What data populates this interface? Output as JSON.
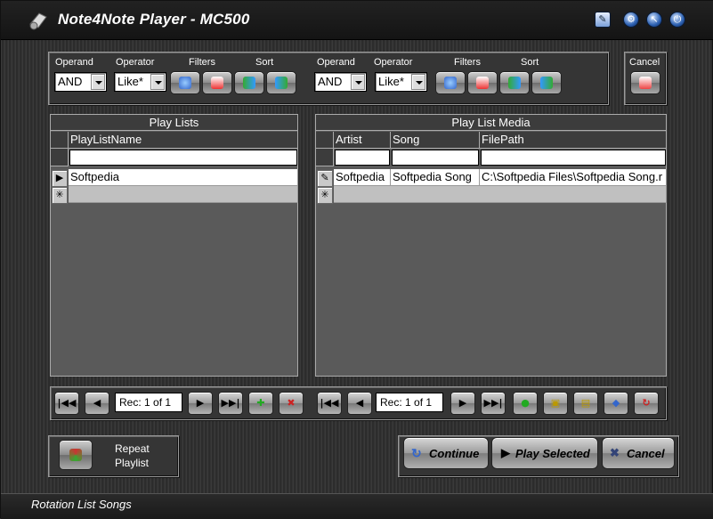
{
  "window": {
    "title": "Note4Note Player - MC500"
  },
  "filters_left": {
    "operand_label": "Operand",
    "operator_label": "Operator",
    "filters_label": "Filters",
    "sort_label": "Sort",
    "operand_value": "AND",
    "operator_value": "Like*"
  },
  "filters_right": {
    "operand_label": "Operand",
    "operator_label": "Operator",
    "filters_label": "Filters",
    "sort_label": "Sort",
    "operand_value": "AND",
    "operator_value": "Like*"
  },
  "cancel_top_label": "Cancel",
  "playlists": {
    "title": "Play Lists",
    "column": "PlayListName",
    "rows": [
      {
        "name": "Softpedia"
      }
    ]
  },
  "media": {
    "title": "Play List Media",
    "columns": [
      "Artist",
      "Song",
      "FilePath"
    ],
    "rows": [
      {
        "artist": "Softpedia",
        "song": "Softpedia Song",
        "path": "C:\\Softpedia Files\\Softpedia Song.r"
      }
    ]
  },
  "nav_left": {
    "rec": "Rec: 1 of 1"
  },
  "nav_right": {
    "rec": "Rec: 1 of 1"
  },
  "repeat": {
    "line1": "Repeat",
    "line2": "Playlist"
  },
  "buttons": {
    "continue": "Continue",
    "play_selected": "Play Selected",
    "cancel": "Cancel"
  },
  "status": {
    "text": "Rotation List Songs"
  },
  "colors": {
    "accent_blue": "#2b5fb0",
    "panel": "#353535",
    "grid": "#5a5a5a"
  }
}
